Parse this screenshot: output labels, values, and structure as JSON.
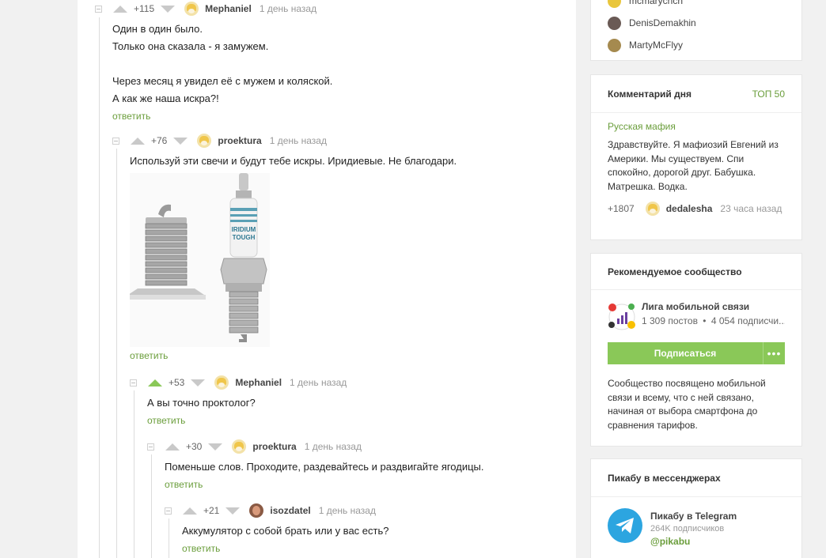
{
  "comments": [
    {
      "rating": "+115",
      "author": "Mephaniel",
      "time": "1 день назад",
      "text": "Один в один было.\nТолько она сказала - я замужем.\n\nЧерез месяц я увидел её с мужем и коляской.\nА как же наша искра?!",
      "reply": "ответить",
      "upvoted": false
    },
    {
      "rating": "+76",
      "author": "proektura",
      "time": "1 день назад",
      "text": "Используй эти свечи и будут тебе искры. Иридиевые. Не благодари.",
      "reply": "ответить",
      "image_text": "IRIDIUM TOUGH",
      "upvoted": false
    },
    {
      "rating": "+53",
      "author": "Mephaniel",
      "time": "1 день назад",
      "text": "А вы точно проктолог?",
      "reply": "ответить",
      "upvoted": true
    },
    {
      "rating": "+30",
      "author": "proektura",
      "time": "1 день назад",
      "text": "Поменьше слов. Проходите, раздевайтесь и раздвигайте ягодицы.",
      "reply": "ответить",
      "upvoted": false
    },
    {
      "rating": "+21",
      "author": "isozdatel",
      "time": "1 день назад",
      "text": "Аккумулятор с собой брать или у вас есть?",
      "reply": "ответить",
      "upvoted": false
    }
  ],
  "sidebar": {
    "users": [
      "mcmarychch",
      "DenisDemakhin",
      "MartyMcFlyy"
    ],
    "comment_of_day": {
      "title": "Комментарий дня",
      "top_link": "ТОП 50",
      "community": "Русская мафия",
      "text": "Здравствуйте. Я мафиозий Евгений из Америки. Мы существуем. Спи спокойно, дорогой друг. Бабушка. Матрешка. Водка.",
      "rating": "+1807",
      "author": "dedalesha",
      "time": "23 часа назад"
    },
    "recommended": {
      "title": "Рекомендуемое сообщество",
      "name": "Лига мобильной связи",
      "posts": "1 309 постов",
      "subscribers": "4 054 подписчи...",
      "subscribe_label": "Подписаться",
      "more_label": "•••",
      "description": "Сообщество посвящено мобильной связи и всему, что с ней связано, начиная от выбора смартфона до сравнения тарифов."
    },
    "messengers": {
      "title": "Пикабу в мессенджерах",
      "name": "Пикабу в Telegram",
      "subscribers": "264K подписчиков",
      "handle": "@pikabu"
    }
  },
  "colors": {
    "accent": "#8ac858",
    "link": "#6b9e3c",
    "telegram": "#2ca5e0"
  }
}
